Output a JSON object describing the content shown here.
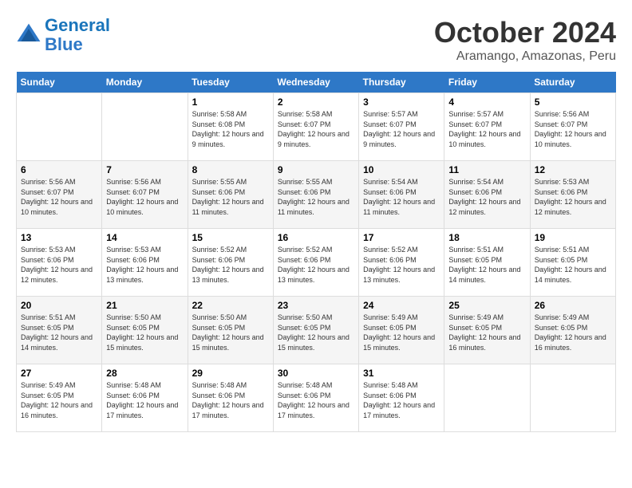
{
  "header": {
    "logo_line1": "General",
    "logo_line2": "Blue",
    "month": "October 2024",
    "location": "Aramango, Amazonas, Peru"
  },
  "weekdays": [
    "Sunday",
    "Monday",
    "Tuesday",
    "Wednesday",
    "Thursday",
    "Friday",
    "Saturday"
  ],
  "weeks": [
    [
      {
        "day": "",
        "info": ""
      },
      {
        "day": "",
        "info": ""
      },
      {
        "day": "1",
        "sunrise": "5:58 AM",
        "sunset": "6:08 PM",
        "daylight": "12 hours and 9 minutes."
      },
      {
        "day": "2",
        "sunrise": "5:58 AM",
        "sunset": "6:07 PM",
        "daylight": "12 hours and 9 minutes."
      },
      {
        "day": "3",
        "sunrise": "5:57 AM",
        "sunset": "6:07 PM",
        "daylight": "12 hours and 9 minutes."
      },
      {
        "day": "4",
        "sunrise": "5:57 AM",
        "sunset": "6:07 PM",
        "daylight": "12 hours and 10 minutes."
      },
      {
        "day": "5",
        "sunrise": "5:56 AM",
        "sunset": "6:07 PM",
        "daylight": "12 hours and 10 minutes."
      }
    ],
    [
      {
        "day": "6",
        "sunrise": "5:56 AM",
        "sunset": "6:07 PM",
        "daylight": "12 hours and 10 minutes."
      },
      {
        "day": "7",
        "sunrise": "5:56 AM",
        "sunset": "6:07 PM",
        "daylight": "12 hours and 10 minutes."
      },
      {
        "day": "8",
        "sunrise": "5:55 AM",
        "sunset": "6:06 PM",
        "daylight": "12 hours and 11 minutes."
      },
      {
        "day": "9",
        "sunrise": "5:55 AM",
        "sunset": "6:06 PM",
        "daylight": "12 hours and 11 minutes."
      },
      {
        "day": "10",
        "sunrise": "5:54 AM",
        "sunset": "6:06 PM",
        "daylight": "12 hours and 11 minutes."
      },
      {
        "day": "11",
        "sunrise": "5:54 AM",
        "sunset": "6:06 PM",
        "daylight": "12 hours and 12 minutes."
      },
      {
        "day": "12",
        "sunrise": "5:53 AM",
        "sunset": "6:06 PM",
        "daylight": "12 hours and 12 minutes."
      }
    ],
    [
      {
        "day": "13",
        "sunrise": "5:53 AM",
        "sunset": "6:06 PM",
        "daylight": "12 hours and 12 minutes."
      },
      {
        "day": "14",
        "sunrise": "5:53 AM",
        "sunset": "6:06 PM",
        "daylight": "12 hours and 13 minutes."
      },
      {
        "day": "15",
        "sunrise": "5:52 AM",
        "sunset": "6:06 PM",
        "daylight": "12 hours and 13 minutes."
      },
      {
        "day": "16",
        "sunrise": "5:52 AM",
        "sunset": "6:06 PM",
        "daylight": "12 hours and 13 minutes."
      },
      {
        "day": "17",
        "sunrise": "5:52 AM",
        "sunset": "6:06 PM",
        "daylight": "12 hours and 13 minutes."
      },
      {
        "day": "18",
        "sunrise": "5:51 AM",
        "sunset": "6:05 PM",
        "daylight": "12 hours and 14 minutes."
      },
      {
        "day": "19",
        "sunrise": "5:51 AM",
        "sunset": "6:05 PM",
        "daylight": "12 hours and 14 minutes."
      }
    ],
    [
      {
        "day": "20",
        "sunrise": "5:51 AM",
        "sunset": "6:05 PM",
        "daylight": "12 hours and 14 minutes."
      },
      {
        "day": "21",
        "sunrise": "5:50 AM",
        "sunset": "6:05 PM",
        "daylight": "12 hours and 15 minutes."
      },
      {
        "day": "22",
        "sunrise": "5:50 AM",
        "sunset": "6:05 PM",
        "daylight": "12 hours and 15 minutes."
      },
      {
        "day": "23",
        "sunrise": "5:50 AM",
        "sunset": "6:05 PM",
        "daylight": "12 hours and 15 minutes."
      },
      {
        "day": "24",
        "sunrise": "5:49 AM",
        "sunset": "6:05 PM",
        "daylight": "12 hours and 15 minutes."
      },
      {
        "day": "25",
        "sunrise": "5:49 AM",
        "sunset": "6:05 PM",
        "daylight": "12 hours and 16 minutes."
      },
      {
        "day": "26",
        "sunrise": "5:49 AM",
        "sunset": "6:05 PM",
        "daylight": "12 hours and 16 minutes."
      }
    ],
    [
      {
        "day": "27",
        "sunrise": "5:49 AM",
        "sunset": "6:05 PM",
        "daylight": "12 hours and 16 minutes."
      },
      {
        "day": "28",
        "sunrise": "5:48 AM",
        "sunset": "6:06 PM",
        "daylight": "12 hours and 17 minutes."
      },
      {
        "day": "29",
        "sunrise": "5:48 AM",
        "sunset": "6:06 PM",
        "daylight": "12 hours and 17 minutes."
      },
      {
        "day": "30",
        "sunrise": "5:48 AM",
        "sunset": "6:06 PM",
        "daylight": "12 hours and 17 minutes."
      },
      {
        "day": "31",
        "sunrise": "5:48 AM",
        "sunset": "6:06 PM",
        "daylight": "12 hours and 17 minutes."
      },
      {
        "day": "",
        "info": ""
      },
      {
        "day": "",
        "info": ""
      }
    ]
  ]
}
